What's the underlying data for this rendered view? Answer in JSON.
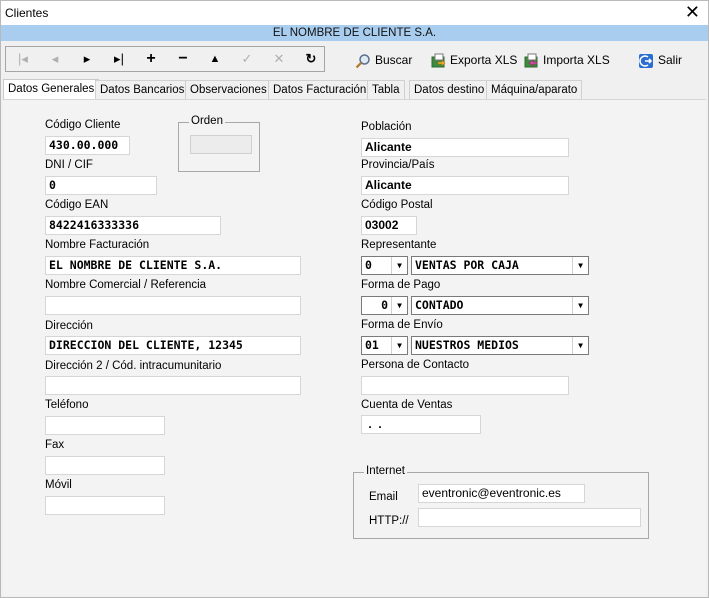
{
  "window": {
    "title": "Clientes",
    "close": "✕"
  },
  "banner": "EL NOMBRE DE CLIENTE S.A.",
  "toolbar": {
    "nav": [
      "|◂",
      "◂",
      "▸",
      "▸|",
      "+",
      "−",
      "▲",
      "✓",
      "✕",
      "↻"
    ],
    "buscar": "Buscar",
    "exporta": "Exporta XLS",
    "importa": "Importa XLS",
    "salir": "Salir"
  },
  "tabs": [
    "Datos Generales",
    "Datos Bancarios",
    "Observaciones",
    "Datos Facturación",
    "Tabla",
    "Datos destino",
    "Máquina/aparato"
  ],
  "left": {
    "codigo_label": "Código Cliente",
    "codigo_value": "430.00.000",
    "orden_label": "Orden",
    "orden_value": "",
    "dni_label": "DNI / CIF",
    "dni_value": "0",
    "ean_label": "Código EAN",
    "ean_value": "8422416333336",
    "nombre_fact_label": "Nombre Facturación",
    "nombre_fact_value": "EL NOMBRE DE CLIENTE S.A.",
    "nombre_com_label": "Nombre Comercial / Referencia",
    "nombre_com_value": "",
    "direccion_label": "Dirección",
    "direccion_value": "DIRECCION DEL CLIENTE, 12345",
    "direccion2_label": "Dirección 2 / Cód. intracumunitario",
    "direccion2_value": "",
    "telefono_label": "Teléfono",
    "telefono_value": "",
    "fax_label": "Fax",
    "fax_value": "",
    "movil_label": "Móvil",
    "movil_value": ""
  },
  "right": {
    "poblacion_label": "Población",
    "poblacion_value": "Alicante",
    "provincia_label": "Provincia/País",
    "provincia_value": "Alicante",
    "cp_label": "Código Postal",
    "cp_value": "03002",
    "representante_label": "Representante",
    "representante_code": "0",
    "representante_value": "VENTAS POR CAJA",
    "pago_label": "Forma de Pago",
    "pago_code": "0",
    "pago_value": "CONTADO",
    "envio_label": "Forma de Envío",
    "envio_code": "01",
    "envio_value": "NUESTROS MEDIOS",
    "contacto_label": "Persona de Contacto",
    "contacto_value": "",
    "cuenta_label": "Cuenta de Ventas",
    "cuenta_value": " .  ."
  },
  "internet": {
    "title": "Internet",
    "email_label": "Email",
    "email_value": "eventronic@eventronic.es",
    "http_label": "HTTP://",
    "http_value": ""
  },
  "colors": {
    "banner": "#a9cdee",
    "accent": "#2a6fcf"
  }
}
